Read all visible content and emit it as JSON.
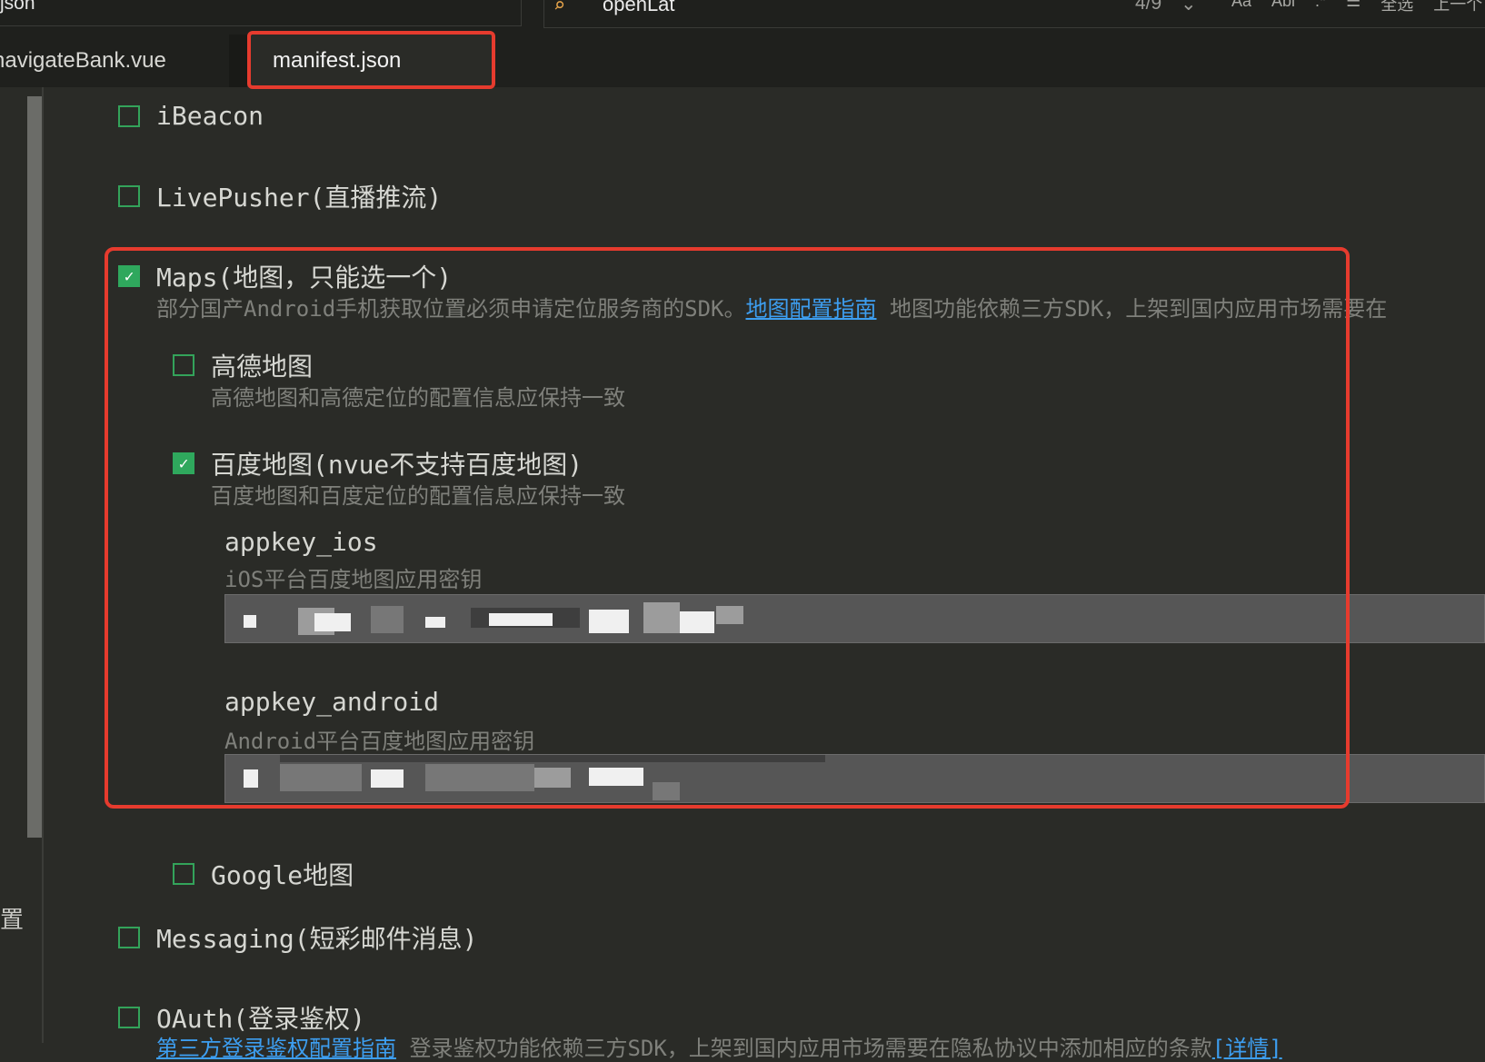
{
  "window": {
    "file_title": "json"
  },
  "search": {
    "query": "openLat",
    "match_count": "4/9",
    "tools": [
      "Aa",
      "Abl",
      ".*",
      "全选",
      "上一个"
    ]
  },
  "tabs": [
    {
      "label": "navigateBank.vue",
      "active": false
    },
    {
      "label": "manifest.json",
      "active": true
    }
  ],
  "modules": {
    "ibeacon": {
      "label": "iBeacon",
      "checked": false
    },
    "livepusher": {
      "label": "LivePusher(直播推流)",
      "checked": false
    },
    "maps": {
      "label": "Maps(地图，只能选一个)",
      "checked": true,
      "desc_before": "部分国产Android手机获取位置必须申请定位服务商的SDK。",
      "desc_link": "地图配置指南",
      "desc_after": " 地图功能依赖三方SDK，上架到国内应用市场需要在",
      "amap": {
        "label": "高德地图",
        "checked": false,
        "desc": "高德地图和高德定位的配置信息应保持一致"
      },
      "baidu": {
        "label": "百度地图(nvue不支持百度地图)",
        "checked": true,
        "desc": "百度地图和百度定位的配置信息应保持一致",
        "appkey_ios": {
          "label": "appkey_ios",
          "desc": "iOS平台百度地图应用密钥"
        },
        "appkey_android": {
          "label": "appkey_android",
          "desc": "Android平台百度地图应用密钥"
        }
      },
      "google": {
        "label": "Google地图",
        "checked": false
      }
    },
    "messaging": {
      "label": "Messaging(短彩邮件消息)",
      "checked": false
    },
    "oauth": {
      "label": "OAuth(登录鉴权)",
      "checked": false,
      "desc_link": "第三方登录鉴权配置指南",
      "desc_after": " 登录鉴权功能依赖三方SDK，上架到国内应用市场需要在隐私协议中添加相应的条款",
      "desc_link2": "[详情]"
    }
  },
  "gutter": {
    "char": "置"
  },
  "colors": {
    "accent_green": "#2fa85d",
    "highlight_red": "#e63b2e",
    "link_blue": "#3d9ef0"
  }
}
